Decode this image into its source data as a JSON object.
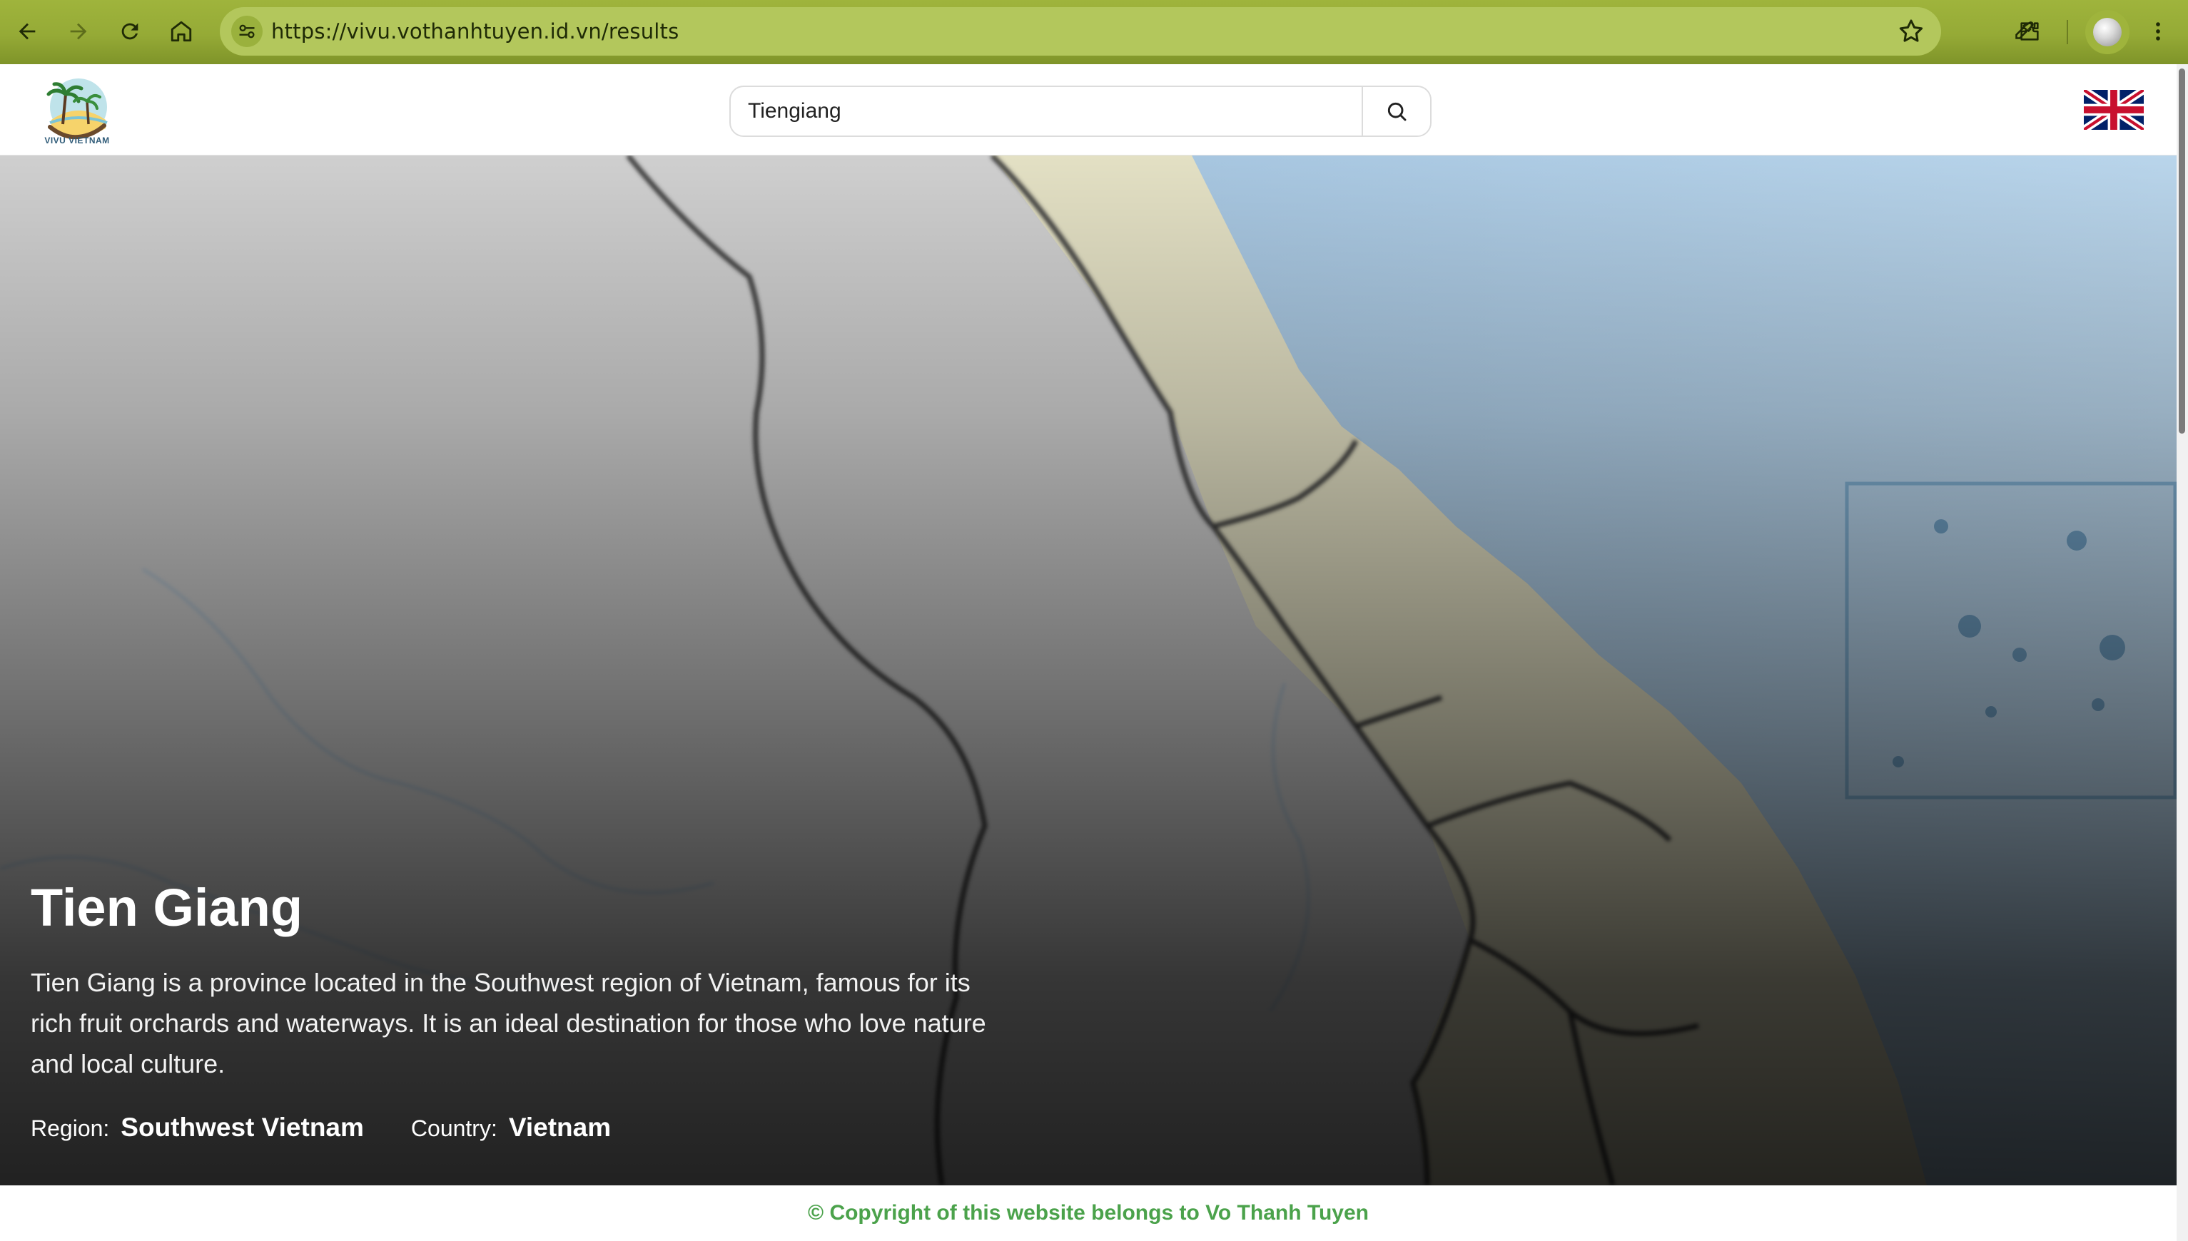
{
  "browser": {
    "url": "https://vivu.vothanhtuyen.id.vn/results",
    "toolbar_color": "#9fb43c"
  },
  "header": {
    "logo_caption": "VIVU VIETNAM",
    "search": {
      "value": "Tiengiang",
      "placeholder": ""
    },
    "language_flag_icon": "uk-flag-icon"
  },
  "hero": {
    "title": "Tien Giang",
    "description": "Tien Giang is a province located in the Southwest region of Vietnam, famous for its rich fruit orchards and waterways. It is an ideal destination for those who love nature and local culture.",
    "region_label": "Region:",
    "region_value": "Southwest Vietnam",
    "country_label": "Country:",
    "country_value": "Vietnam"
  },
  "footer": {
    "copyright": "© Copyright of this website belongs to Vo Thanh Tuyen",
    "color": "#4ba24b"
  },
  "icons": [
    "back-arrow-icon",
    "forward-arrow-icon",
    "reload-icon",
    "home-icon",
    "site-info-icon",
    "bookmark-star-icon",
    "eyedropper-icon",
    "extensions-icon",
    "profile-avatar",
    "more-menu-icon",
    "search-icon"
  ]
}
